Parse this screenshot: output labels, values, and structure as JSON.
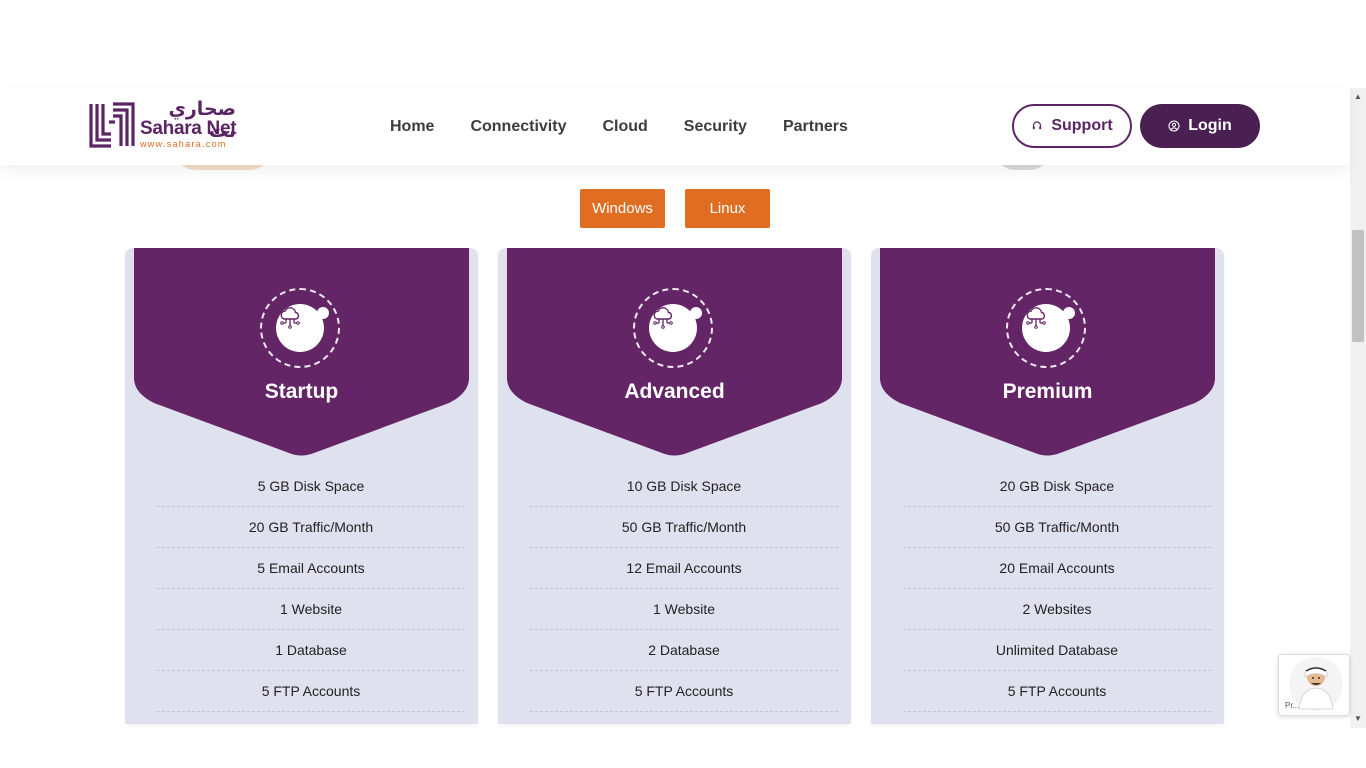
{
  "brand": {
    "name_ar": "صحاري نت",
    "name_en": "Sahara Net",
    "url": "www.sahara.com",
    "primary_color": "#5b2564",
    "accent_color": "#e0691f"
  },
  "nav": {
    "items": [
      {
        "label": "Home"
      },
      {
        "label": "Connectivity"
      },
      {
        "label": "Cloud"
      },
      {
        "label": "Security"
      },
      {
        "label": "Partners"
      }
    ]
  },
  "header_actions": {
    "support_label": "Support",
    "support_icon": "headset-icon",
    "login_label": "Login",
    "login_icon": "user-circle-icon"
  },
  "os_tabs": [
    {
      "label": "Windows"
    },
    {
      "label": "Linux"
    }
  ],
  "plans": [
    {
      "name": "Startup",
      "icon": "cloud-network-icon",
      "features": [
        "5 GB Disk Space",
        "20 GB Traffic/Month",
        "5 Email Accounts",
        "1 Website",
        "1 Database",
        "5 FTP Accounts"
      ]
    },
    {
      "name": "Advanced",
      "icon": "cloud-network-icon",
      "features": [
        "10 GB Disk Space",
        "50 GB Traffic/Month",
        "12 Email Accounts",
        "1 Website",
        "2 Database",
        "5 FTP Accounts"
      ]
    },
    {
      "name": "Premium",
      "icon": "cloud-network-icon",
      "features": [
        "20 GB Disk Space",
        "50 GB Traffic/Month",
        "20 Email Accounts",
        "2 Websites",
        "Unlimited Database",
        "5 FTP Accounts"
      ]
    }
  ],
  "colors": {
    "card_bg": "#e0e1ee",
    "card_header": "#632566",
    "tab_orange": "#df6d22",
    "login_bg": "#4a1f52"
  },
  "chat_widget": {
    "icon": "chat-assistant-avatar",
    "footer_text": "Pr..."
  }
}
